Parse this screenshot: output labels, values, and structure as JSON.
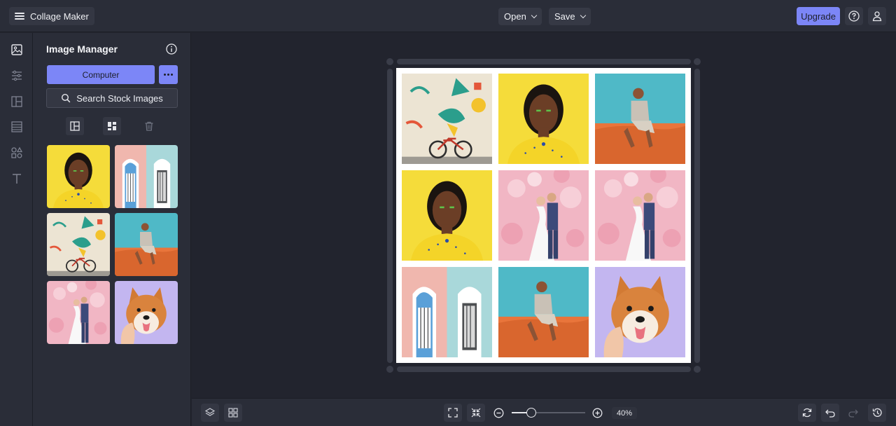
{
  "app": {
    "title": "Collage Maker"
  },
  "header": {
    "open_label": "Open",
    "save_label": "Save",
    "upgrade_label": "Upgrade"
  },
  "panel": {
    "title": "Image Manager",
    "computer_label": "Computer",
    "search_label": "Search Stock Images"
  },
  "rail": {
    "items": [
      "image-icon",
      "adjust-icon",
      "layout-icon",
      "texture-icon",
      "shapes-icon",
      "text-icon"
    ]
  },
  "gallery": {
    "items": [
      "portrait-yellow",
      "doors-pastel",
      "mural-bicycle",
      "man-desert",
      "couple-flowers",
      "shiba-dog"
    ]
  },
  "collage": {
    "cells": [
      "mural-bicycle",
      "portrait-yellow",
      "man-desert",
      "portrait-yellow",
      "couple-flowers",
      "couple-flowers",
      "doors-pastel",
      "man-desert",
      "shiba-dog"
    ]
  },
  "zoom": {
    "value": "40%",
    "level": 0.27
  },
  "colors": {
    "accent": "#7c86f7",
    "background": "#22242e",
    "panel": "#2a2d38"
  }
}
